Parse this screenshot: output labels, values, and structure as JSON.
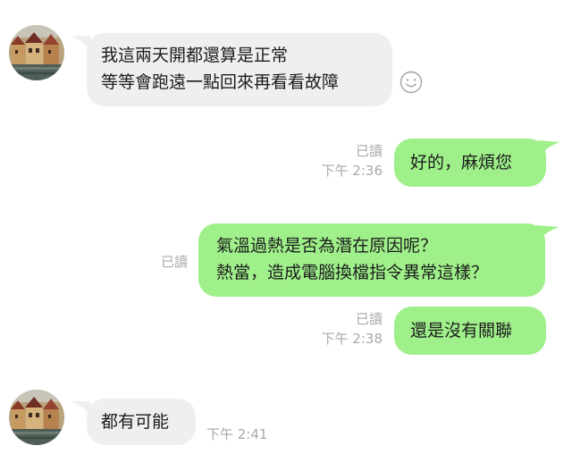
{
  "messages": [
    {
      "side": "incoming",
      "lines": [
        "我這兩天開都還算是正常",
        "等等會跑遠一點回來再看看故障"
      ]
    },
    {
      "side": "outgoing",
      "text": "好的，麻煩您",
      "read": "已讀",
      "time": "下午 2:36"
    },
    {
      "side": "outgoing",
      "lines": [
        "氣溫過熱是否為潛在原因呢？",
        "熱當，造成電腦換檔指令異常這樣？"
      ],
      "read": "已讀"
    },
    {
      "side": "outgoing",
      "text": "還是沒有關聯",
      "read": "已讀",
      "time": "下午 2:38"
    },
    {
      "side": "incoming",
      "text": "都有可能",
      "time": "下午 2:41"
    }
  ],
  "icons": {
    "reaction": "smiley-icon",
    "avatar": "contact-avatar"
  },
  "colors": {
    "incoming_bubble": "#efefef",
    "outgoing_bubble": "#9ff08a",
    "meta_text": "#a8a8a8"
  }
}
